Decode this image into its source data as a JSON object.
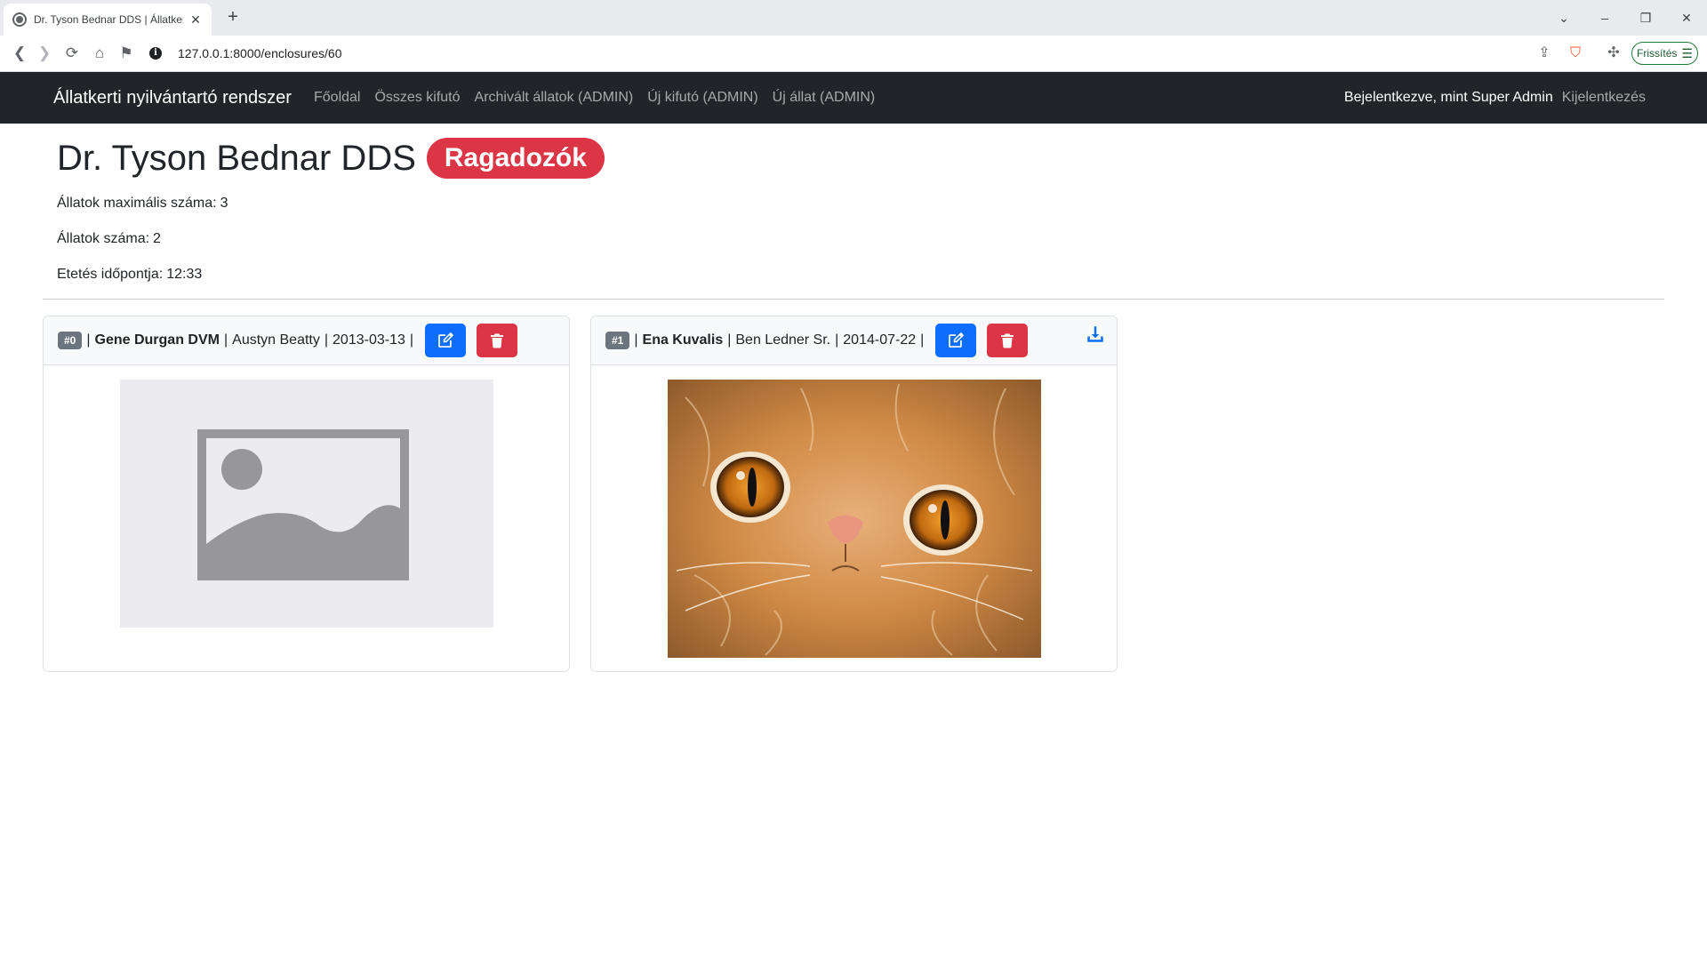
{
  "browser": {
    "tab_title": "Dr. Tyson Bednar DDS | Állatkertek",
    "url": "127.0.0.1:8000/enclosures/60",
    "update_label": "Frissítés"
  },
  "navbar": {
    "brand": "Állatkerti nyilvántartó rendszer",
    "links": [
      "Főoldal",
      "Összes kifutó",
      "Archivált állatok (ADMIN)",
      "Új kifutó (ADMIN)",
      "Új állat (ADMIN)"
    ],
    "logged_in": "Bejelentkezve, mint Super Admin",
    "logout": "Kijelentkezés"
  },
  "enclosure": {
    "name": "Dr. Tyson Bednar DDS",
    "category": "Ragadozók",
    "max_animals_label": "Állatok maximális száma:",
    "max_animals": "3",
    "animal_count_label": "Állatok száma:",
    "animal_count": "2",
    "feeding_label": "Etetés időpontja:",
    "feeding_time": "12:33"
  },
  "animals": [
    {
      "id": "#0",
      "name": "Gene Durgan DVM",
      "caretaker": "Austyn Beatty",
      "date": "2013-03-13",
      "image": "placeholder-image",
      "downloadable": false
    },
    {
      "id": "#1",
      "name": "Ena Kuvalis",
      "caretaker": "Ben Ledner Sr.",
      "date": "2014-07-22",
      "image": "orange-persian-cat-photo",
      "downloadable": true
    }
  ],
  "colors": {
    "navbar_bg": "#212529",
    "danger": "#dc3545",
    "primary": "#0d6efd",
    "secondary": "#6c757d"
  }
}
